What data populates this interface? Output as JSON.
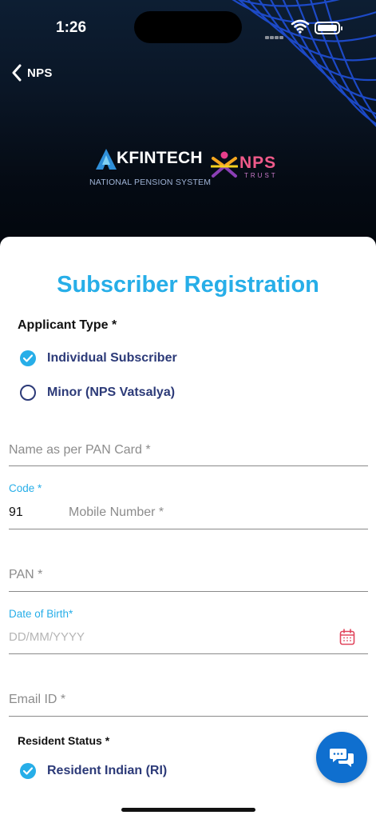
{
  "status_bar": {
    "time": "1:26"
  },
  "nav": {
    "back_label": "NPS"
  },
  "branding": {
    "kfintech_name": "KFINTECH",
    "kfintech_tagline": "NATIONAL PENSION SYSTEM",
    "nps_name": "NPS",
    "nps_sub": "TRUST"
  },
  "form": {
    "title": "Subscriber Registration",
    "applicant_type": {
      "label": "Applicant Type *",
      "options": [
        {
          "label": "Individual Subscriber",
          "selected": true
        },
        {
          "label": "Minor (NPS Vatsalya)",
          "selected": false
        }
      ]
    },
    "name_field": {
      "placeholder": "Name as per PAN Card *"
    },
    "mobile": {
      "code_label": "Code *",
      "code_value": "91",
      "placeholder": "Mobile Number *"
    },
    "pan_field": {
      "placeholder": "PAN *"
    },
    "dob": {
      "label": "Date of Birth*",
      "placeholder": "DD/MM/YYYY"
    },
    "email_field": {
      "placeholder": "Email ID *"
    },
    "resident_status": {
      "label": "Resident Status *",
      "options": [
        {
          "label": "Resident Indian (RI)",
          "selected": true
        }
      ]
    }
  },
  "colors": {
    "accent": "#27aee8",
    "label_text": "#2c3a78",
    "chat_button": "#0f6fcf",
    "calendar_icon": "#e0455c"
  },
  "icons": [
    "chevron-left-icon",
    "wifi-icon",
    "battery-icon",
    "check-icon",
    "calendar-icon",
    "chat-icon"
  ]
}
